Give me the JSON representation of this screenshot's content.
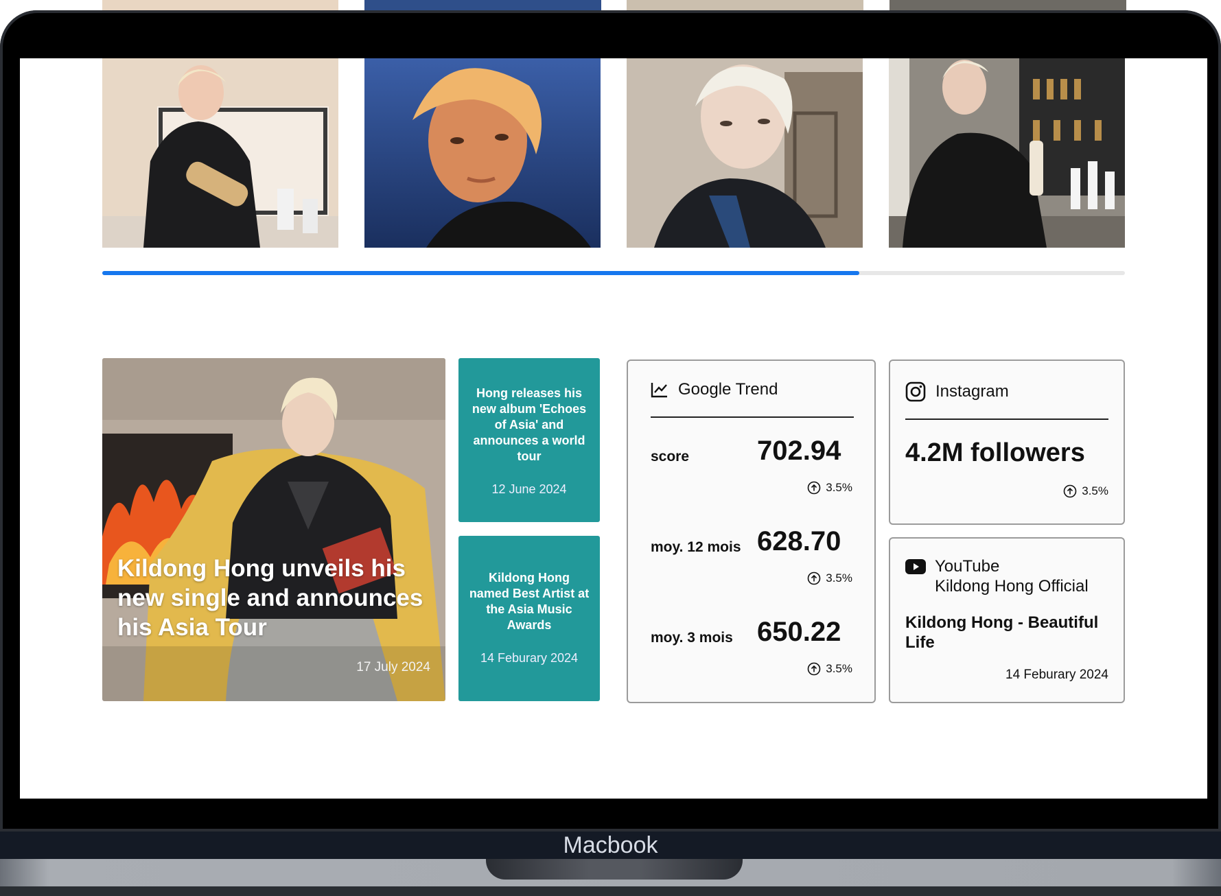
{
  "gallery": {
    "images": [
      {
        "name": "gallery-photo-bottle"
      },
      {
        "name": "gallery-photo-portrait-blue"
      },
      {
        "name": "gallery-photo-cafe"
      },
      {
        "name": "gallery-photo-bar"
      }
    ],
    "scroll_progress": 0.74
  },
  "feature": {
    "title": "Kildong Hong unveils his new single and announces his Asia Tour",
    "date": "17 July 2024"
  },
  "news": [
    {
      "title": "Hong releases his new album 'Echoes of Asia' and announces a world tour",
      "date": "12 June 2024"
    },
    {
      "title": "Kildong Hong named Best Artist at the Asia Music Awards",
      "date": "14 Feburary 2024"
    }
  ],
  "google_trend": {
    "icon": "line-chart-icon",
    "label": "Google Trend",
    "metrics": [
      {
        "label": "score",
        "value": "702.94",
        "change": "3.5%"
      },
      {
        "label": "moy. 12 mois",
        "value": "628.70",
        "change": "3.5%"
      },
      {
        "label": "moy. 3 mois",
        "value": "650.22",
        "change": "3.5%"
      }
    ]
  },
  "instagram": {
    "icon": "instagram-icon",
    "label": "Instagram",
    "followers": "4.2M followers",
    "change": "3.5%"
  },
  "youtube": {
    "icon": "youtube-icon",
    "label": "YouTube",
    "channel": "Kildong Hong Official",
    "video_title": "Kildong Hong - Beautiful Life",
    "date": "14 Feburary 2024"
  },
  "device": {
    "label": "Macbook"
  },
  "colors": {
    "accent_blue": "#1677ee",
    "teal": "#22999a"
  }
}
